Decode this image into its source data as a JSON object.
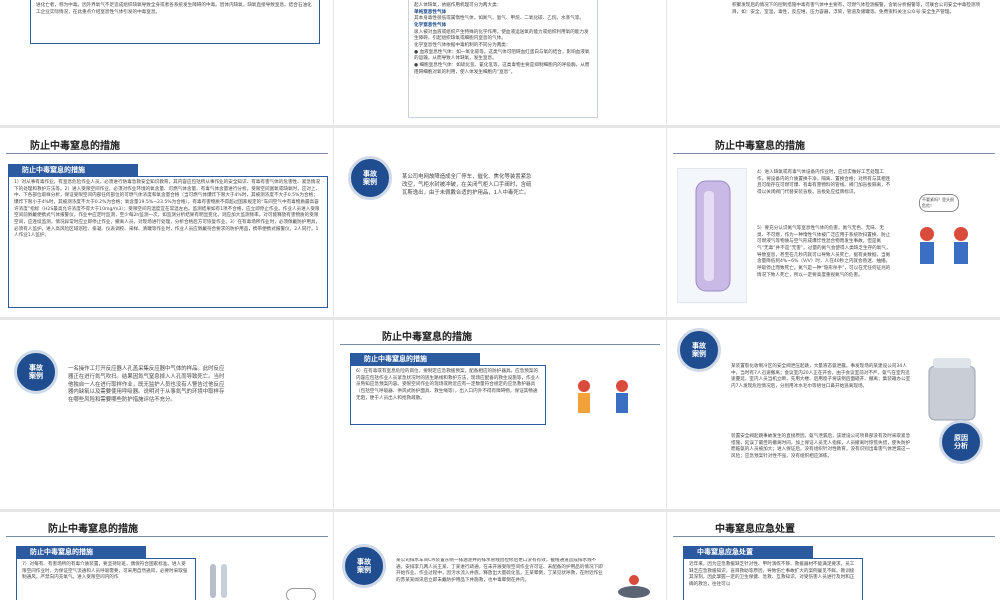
{
  "colors": {
    "accent": "#2c5aa0",
    "circle": "#1f4d8f"
  },
  "slides": {
    "s1": {
      "text": "进化亡者，称为中毒。因外界氧气不足造成组织缺氧导致全身或者各系统发生障碍的中毒。因体内缺氧，缺氧直接导致窒息。结合石油化工企业实际情况，在此重点介绍窒息性气体引发的中毒窒息。"
    },
    "s2": {
      "lines": [
        "起人体缺氧，依据作用机理可分为两大类：",
        "单纯窒息性气体",
        "其本身毒性很低或属惰性气体，如氮气、氩气、甲烷、二氧化碳、乙烷、水蒸气等。",
        "化学窒息性气体",
        "吸入被对血液或组织产生特殊的化学作用，使血液运送氧的能力或组织利用氧的能力发生障碍，引起组织缺氧或细胞内窒息的气体。",
        "化学窒息性气体依据中毒机制的不同分为两类：",
        "● 血液窒息性气体：如一氧化碳等。这类气体可阻碍血红蛋白与氧的结合，影响血液氧的运输，从而导致人体缺氧，发生窒息。",
        "● 细胞窒息性气体：如硫化氢、氰化氢等。这类毒物主要是抑制细胞内的呼吸酶，从而阻碍细胞对氧的利用，使人体发生细胞内“窒息”。"
      ]
    },
    "s3": {
      "text": "积聚发现后的情况下的控制措施中毒有害气体中主要有，可燃气体检测报警，含氧分析报警等，可联合公司安全中毒检测项目，如：安全，室温，毒性，反应堆，压力容器，浮筒，管道及储罐等。免费资料关注公众号:安全生产管理。"
    },
    "s4": {
      "title": "防止中毒窒息的措施",
      "bar": "防止中毒窒息的措施",
      "text": "1）对从事有毒作业，有窒息危险作业人员，必须进行防毒急救安全知识教育，其内容应包括所从事作业的安全知识、有毒有害气体的危害性、紧急情况下的处理和救护方法等。2）进入受限空间作业，必须对作业环境的氧含量、可燃气体含量、有毒气体含量进行分析。受限空间富氧或缺氧时，应对上、中、下各部位取样分析，保证受限空间内部任何部位的可燃气体浓度和氧含量合格（当可燃气体爆炸下限大于4%时，其被测浓度不大于0.5%为合格；爆炸下限小于4%时，其被测浓度不大于0.2%为合格；氧含量19.5%~23.5%为合格），有毒有害物质不得超过国家规定的“车间空气中有毒物质最高容许浓度”指标（H2S最高允许浓度不得大于10mg/m3）；受限空间内温度宜在常温左右。监测结果如有1项不合格，应立即停止作业。作业人员进入受限空间前佩戴便携式气体报警仪，作业中应定时监测，至少每2h监测一次，如监测分析结果有明显变化，则应加大监测频率。对可能释放有害物质的受限空间，应连续监测，情况异常时应立即停止作业，撤离人员，对现场进行处理，分析合格后方可恢复作业。3）在有毒场所作业时，必须佩戴防护用具，必须有人监护。进入高风险区域巡检、排凝、仪表调校、采样、清罐等作业时，作业人员应佩戴符合要求的防护用品，携带便携式报警仪，2人同行，1人作业1人监护。"
    },
    "s5": {
      "badge_l1": "事故",
      "badge_l2": "案例",
      "text": "某公司电网故障造成全厂停车，催化、焦化等装置紧急改空，气柜水封被冲破，在关闭气柜入口手阀时，含硫瓦斯逸出，由于未佩戴合适的护用品，1人中毒死亡。"
    },
    "s6": {
      "title": "防止中毒窒息的措施",
      "p1": "4）进入缺氧或有毒气体设备内作业时，应切实做好工艺处理工作，将设备内的介质置换干净，隔离、置换合格；对所有与其相连且可能存在可燃可爆、有毒有害物料的管线、阀门加盲板隔离，不得以关闭阀门代替安装盲板。盲板处应挂牌标识。",
      "p2": "5）要充分认识氮气等窒息性气体的危害。氮气无色、无味、无臭、不可燃，作为一种惰性气体被广泛应用于系统吹扫置换、防止可燃液气等物质与空气形成爆炸性混合物而发生事故。但是氮气“无毒”并不是“无害”。过量的氮气会使得人类缺乏生存的氧气，导致窒息，甚至在几秒内就可以导致人员死亡。据有关数据，当氮含量降低到4%~6%（V/V）时，人在40秒之内就会昏迷、抽搐，呼吸停止而致死亡。氮气是一种“隐形杀手”，可以在无任何征兆的情况下致人死亡，所以一定要高度重视氮气的危害。",
      "bubble": "不要紧吗？里头很危险！"
    },
    "s7": {
      "badge_l1": "事故",
      "badge_l2": "案例",
      "text": "一名操作工打开反应器人孔盖采集反应器中气体的样品。此时反应器正在进行氮气吹扫。结果因氮气窒息掉入人孔而导致死亡。当时他独自一人在进行取样作业，既无监护人员也没有人警告过他反应器内缺氧以及需要使用呼吸器。说明对于从事氮气的环境中取样存在哪些风险和需要哪些防护措施评估不充分。"
    },
    "s8": {
      "title": "防止中毒窒息的措施",
      "bar": "防止中毒窒息的措施",
      "text": "6）在有毒或有窒息危险的岗位，要制定应急救援预案，配备相应的防护器具。应急预案的内容应包括作业人员紧急状况时的逃生路线和救护方法，现场应配备的救生设施等，作业人员熟知应急预案内容。受限空间作业的现场或附近应有一定数量符合规定的应急救护器具（包括空气呼吸器、供风式防护面具、救生绳等），出入口内外不得有障碍物，保证其畅通无阻，便于人员出入和抢救疏散。"
    },
    "s9": {
      "badge_l1": "事故",
      "badge_l2": "案例",
      "badge2_l1": "原因",
      "badge2_l2": "分析",
      "text1": "某装置裂化收制冷区的安全阀泄压起跳，大量液态氨泄露。事发现场的某建设公司34人中，当时有7人迅速撤离；会议室内20人正在开会，由于会议室前对不严，氨气在室内迅速蔓延，室内人员当机立断，先用大楼、后用窗子将该侧后面砸开、撤离；集装箱办公室内7人发现危险情况后，分别用冰水毛巾等捂住口鼻开始逃离现场。",
      "text2": "装置安全阀起跳事故发生的直接原因。氨气泄漏后，该建设公司项目部没有及时采取紧急措施，延误了最佳的撤离时间，加上保证人员无人指挥，人员撤离时惊慌失措，使失防护而临氨的人员被加大；进入保证后，没有组织针对性教育，没有识别出毒害气体泄漏这一风险；应急预案针对性不强，没有组织相应演练。"
    },
    "s10": {
      "title": "防止中毒窒息的措施",
      "bar": "防止中毒窒息的措施",
      "text": "7）对每有、有害场所的有毒介质装置，要坚持轮班，偶保符合国家标准。进入受限空间作业时，为保证空气流通和人员呼吸需要，可采用自然通风，必要时采取强制通风，严禁向内充氧气。进入受限空间内的作"
    },
    "s11": {
      "badge_l1": "事故",
      "badge_l2": "案例",
      "text": "某公司排水车间CPI装置东侧一排油泥井的排水管线因检修后更口没有有效，截线通道造成排水线不通，安排李几两人员王某、丁某进行疏通，在未开展受限空间作业许可证、未配备的护用品的情况下即开始作业。作业过程中，因污水流入井底，释放出大量硫化氢，王某晕倒，丁某见状呼救，在附近作业的苏某某闻讯后立即未戴防护用品下井施救，也中毒晕倒在井内。"
    },
    "s12": {
      "title": "中毒窒息应急处置",
      "bar": "中毒窒息应急处置",
      "text": "近年来，因为应急救援缺乏针对性、甲时演练不够、救援器材不能满足要求，员工缺乏应急救援知识，盲目救助等原因，导致伤亡事故扩大的案例屡见不鲜。教训极其深刻，因此掌握一定的卫生保健、急救、互救知识，对受伤害人员进行及时和正确的救治，往往可以"
    }
  }
}
